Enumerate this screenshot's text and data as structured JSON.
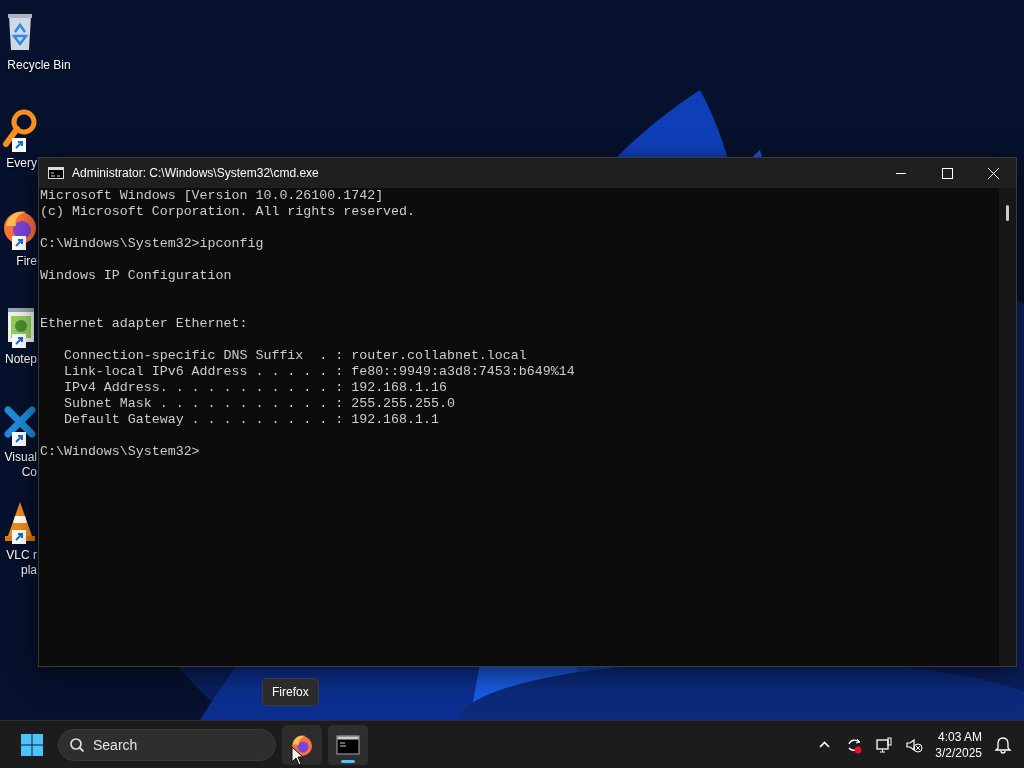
{
  "desktop_icons": [
    {
      "kind": "recycle",
      "label_lines": [
        "Recycle Bin"
      ],
      "shortcut": false,
      "covered": false
    },
    {
      "kind": "magnifier",
      "label_lines": [
        "Every"
      ],
      "shortcut": true,
      "covered": true
    },
    {
      "kind": "firefox",
      "label_lines": [
        "Fire"
      ],
      "shortcut": true,
      "covered": true
    },
    {
      "kind": "notepad",
      "label_lines": [
        "Notep"
      ],
      "shortcut": true,
      "covered": true
    },
    {
      "kind": "code",
      "label_lines": [
        "Visual",
        "Co"
      ],
      "shortcut": true,
      "covered": true
    },
    {
      "kind": "cone",
      "label_lines": [
        "VLC r",
        "pla"
      ],
      "shortcut": true,
      "covered": true
    }
  ],
  "window": {
    "title": "Administrator: C:\\Windows\\System32\\cmd.exe",
    "console": [
      {
        "kind": "line",
        "text": "Microsoft Windows [Version 10.0.26100.1742]"
      },
      {
        "kind": "line",
        "text": "(c) Microsoft Corporation. All rights reserved."
      },
      {
        "kind": "blank"
      },
      {
        "kind": "line",
        "text": "C:\\Windows\\System32>ipconfig"
      },
      {
        "kind": "blank"
      },
      {
        "kind": "line",
        "text": "Windows IP Configuration"
      },
      {
        "kind": "blank"
      },
      {
        "kind": "blank"
      },
      {
        "kind": "line",
        "text": "Ethernet adapter Ethernet:"
      },
      {
        "kind": "blank"
      },
      {
        "kind": "line",
        "text": "   Connection-specific DNS Suffix  . : router.collabnet.local"
      },
      {
        "kind": "line",
        "text": "   Link-local IPv6 Address . . . . . : fe80::9949:a3d8:7453:b649%14"
      },
      {
        "kind": "line",
        "text": "   IPv4 Address. . . . . . . . . . . : 192.168.1.16"
      },
      {
        "kind": "line",
        "text": "   Subnet Mask . . . . . . . . . . . : 255.255.255.0"
      },
      {
        "kind": "line",
        "text": "   Default Gateway . . . . . . . . . : 192.168.1.1"
      },
      {
        "kind": "blank"
      },
      {
        "kind": "line",
        "text": "C:\\Windows\\System32>"
      }
    ]
  },
  "tooltip": "Firefox",
  "taskbar": {
    "search": {
      "placeholder": "Search"
    },
    "apps": [
      {
        "kind": "firefox",
        "selected": false,
        "hovered": true
      },
      {
        "kind": "terminal",
        "selected": true,
        "hovered": false
      }
    ],
    "clock": {
      "time": "4:03 AM",
      "date": "3/2/2025"
    }
  }
}
